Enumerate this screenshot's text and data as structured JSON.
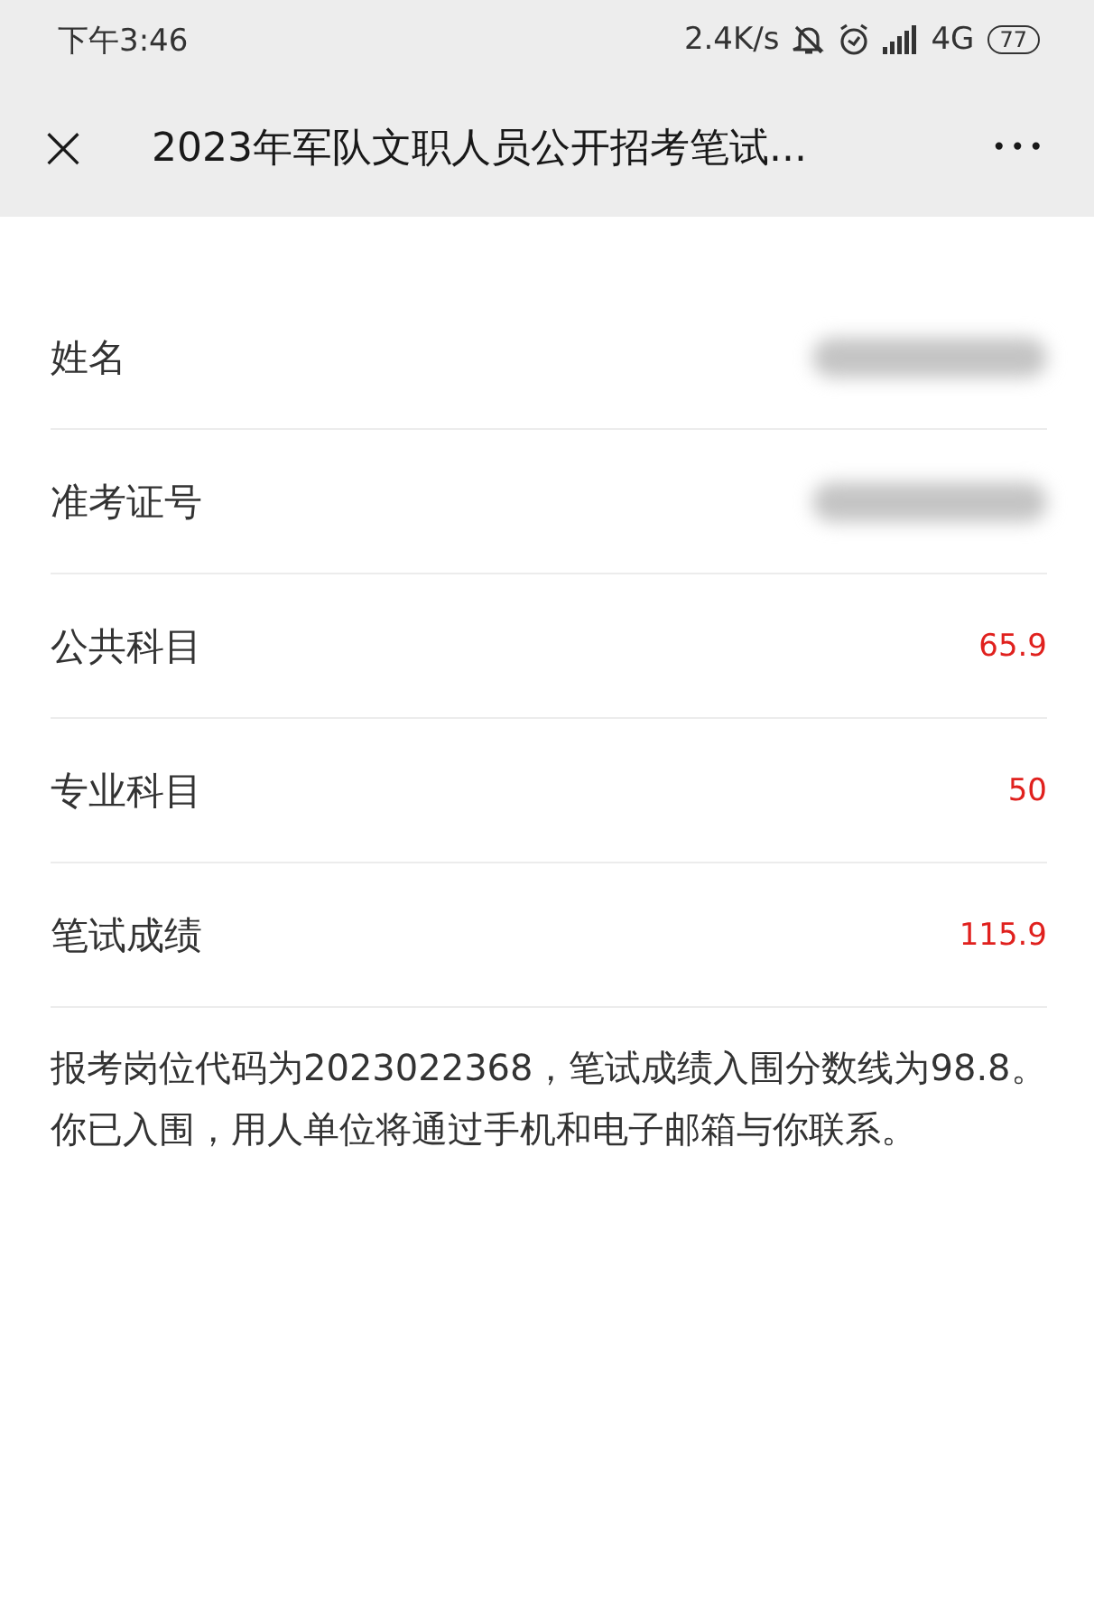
{
  "status_bar": {
    "time": "下午3:46",
    "speed": "2.4K/s",
    "network": "4G",
    "battery": "77"
  },
  "nav": {
    "close": "×",
    "title": "2023年军队文职人员公开招考笔试...",
    "more": "•••"
  },
  "rows": [
    {
      "label": "姓名",
      "kind": "redacted"
    },
    {
      "label": "准考证号",
      "kind": "redacted"
    },
    {
      "label": "公共科目",
      "kind": "value",
      "value": "65.9"
    },
    {
      "label": "专业科目",
      "kind": "value",
      "value": "50"
    },
    {
      "label": "笔试成绩",
      "kind": "value",
      "value": "115.9"
    }
  ],
  "note": "报考岗位代码为2023022368，笔试成绩入围分数线为98.8。你已入围，用人单位将通过手机和电子邮箱与你联系。"
}
